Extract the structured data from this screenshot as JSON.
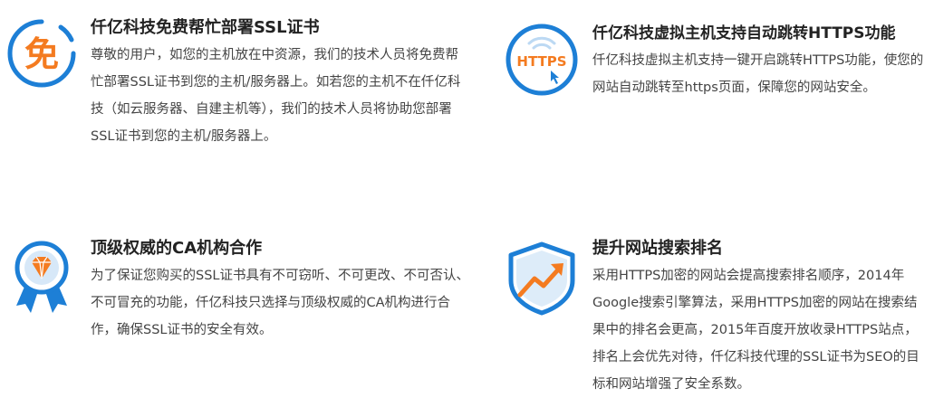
{
  "features": [
    {
      "icon": "free-badge-icon",
      "icon_text": "免",
      "title": "仟亿科技免费帮忙部署SSL证书",
      "description": "尊敬的用户，如您的主机放在中资源，我们的技术人员将免费帮忙部署SSL证书到您的主机/服务器上。如若您的主机不在仟亿科技（如云服务器、自建主机等），我们的技术人员将协助您部署SSL证书到您的主机/服务器上。"
    },
    {
      "icon": "https-redirect-icon",
      "icon_text": "HTTPS",
      "title": "仟亿科技虚拟主机支持自动跳转HTTPS功能",
      "description": "仟亿科技虚拟主机支持一键开启跳转HTTPS功能，使您的网站自动跳转至https页面，保障您的网站安全。"
    },
    {
      "icon": "diamond-award-icon",
      "title": "顶级权威的CA机构合作",
      "description": "为了保证您购买的SSL证书具有不可窃听、不可更改、不可否认、不可冒充的功能，仟亿科技只选择与顶级权威的CA机构进行合作，确保SSL证书的安全有效。"
    },
    {
      "icon": "shield-trend-icon",
      "title": "提升网站搜索排名",
      "description": "采用HTTPS加密的网站会提高搜索排名顺序，2014年Google搜索引擎算法，采用HTTPS加密的网站在搜索结果中的排名会更高，2015年百度开放收录HTTPS站点，排名上会优先对待，仟亿科技代理的SSL证书为SEO的目标和网站增强了安全系数。"
    }
  ],
  "colors": {
    "blue": "#1d7fd6",
    "light_blue": "#bcd9f3",
    "orange": "#f47b20"
  }
}
